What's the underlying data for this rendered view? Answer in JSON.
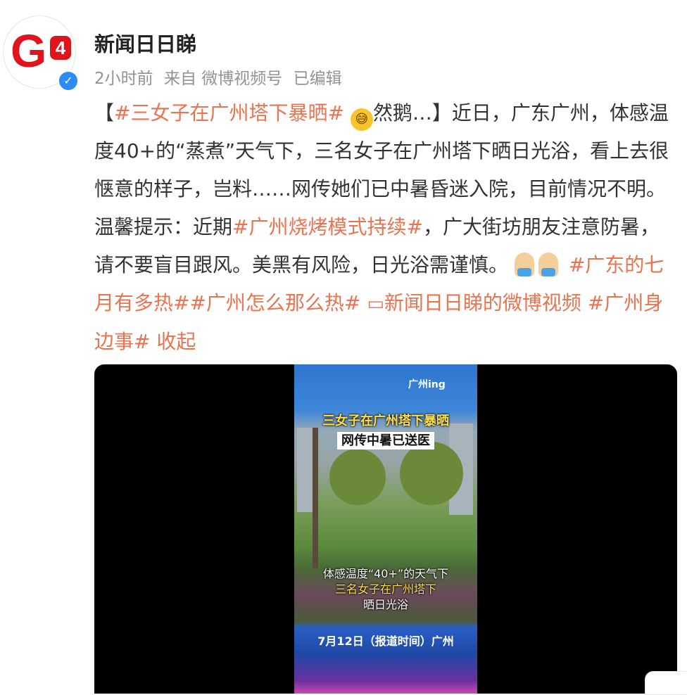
{
  "author": {
    "avatar_text": "G",
    "avatar_badge": "4",
    "verified_icon": "V-verified-icon",
    "name": "新闻日日睇",
    "time": "2小时前",
    "source": "来自 微博视频号",
    "edited": "已编辑"
  },
  "post": {
    "bracket_open": "【",
    "tag1": "#三女子在广州塔下暴晒#",
    "emoji1_text": "然鹅…",
    "bracket_close": "】",
    "body1": "近日，广东广州，体感温度40+的“蒸煮”天气下，三名女子在广州塔下晒日光浴，看上去很惬意的样子，岂料……网传她们已中暑昏迷入院，目前情况不明。温馨提示：近期",
    "tag2": "#广州烧烤模式持续#",
    "body2": "，广大街坊朋友注意防暑，请不要盲目跟风。美黑有风险，日光浴需谨慎。",
    "tag3": "#广东的七月有多热#",
    "tag4": "#广州怎么那么热#",
    "video_link": "新闻日日睇的微博视频",
    "tag5": "#广州身边事#",
    "collapse": "收起"
  },
  "video": {
    "channel": "广州ing",
    "overlay_title1": "三女子在广州塔下暴晒",
    "overlay_title2": "网传中暑已送医",
    "caption1": "体感温度“40+”的天气下",
    "caption2": "三名女子在广州塔下",
    "caption3": "晒日光浴",
    "date_line": "7月12日（报道时间）广州"
  },
  "colors": {
    "accent": "#eb7350",
    "meta": "#939393",
    "video_bg": "#000000"
  }
}
